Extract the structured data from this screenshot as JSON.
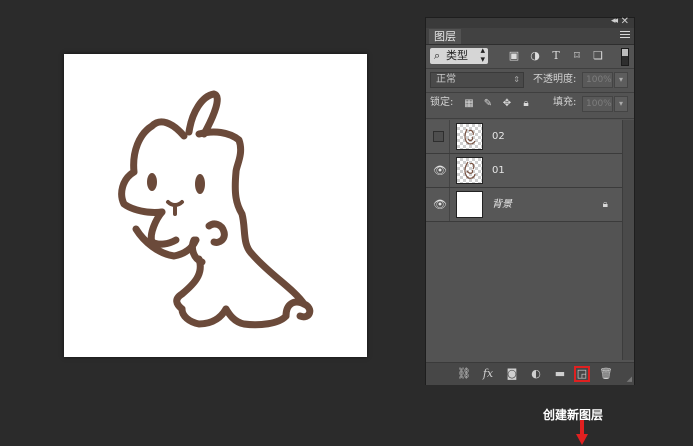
{
  "panel": {
    "tab_title": "图层",
    "collapse_glyph": "◂◂",
    "close_glyph": "✕",
    "filter": {
      "kind_label": "类型",
      "icons": [
        "image-filter-icon",
        "adjustment-filter-icon",
        "type-filter-icon",
        "shape-filter-icon",
        "smart-object-filter-icon"
      ]
    },
    "blend_mode": "正常",
    "opacity_label": "不透明度:",
    "opacity_value": "100%",
    "lock_label": "锁定:",
    "fill_label": "填充:",
    "fill_value": "100%",
    "layers": [
      {
        "name": "02",
        "visible": false,
        "thumb": "transparent"
      },
      {
        "name": "01",
        "visible": true,
        "thumb": "transparent"
      },
      {
        "name": "背景",
        "visible": true,
        "thumb": "white",
        "locked": true
      }
    ],
    "callout_text": "创建新图层",
    "footer_icons": [
      "link-layers-icon",
      "fx-icon",
      "add-mask-icon",
      "adjustment-layer-icon",
      "new-group-icon",
      "new-layer-icon",
      "delete-layer-icon"
    ]
  },
  "colors": {
    "highlight": "#e02020",
    "sketch_stroke": "#6b4a3a",
    "panel_bg": "#535353",
    "workspace_bg": "#2b2b2b"
  }
}
